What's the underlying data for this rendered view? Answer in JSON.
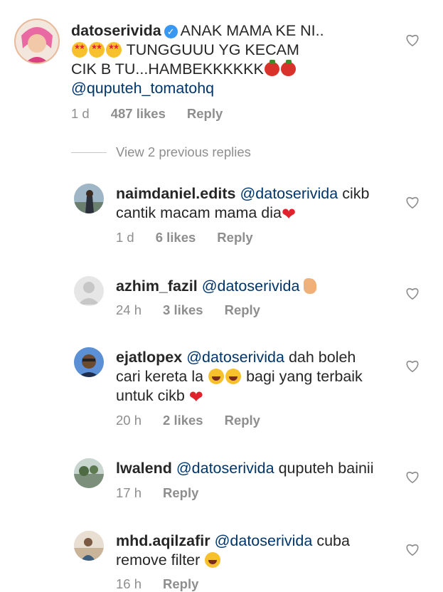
{
  "comments": [
    {
      "username": "datoserivida",
      "verified": true,
      "text_line1": "ANAK MAMA KE NI..",
      "text_line2": "TUNGGUUU YG KECAM",
      "text_line3": "CIK B TU...HAMBEKKKKKK",
      "mention": "@quputeh_tomatohq",
      "time": "1 d",
      "likes": "487 likes",
      "reply": "Reply"
    }
  ],
  "view_previous": "View 2 previous replies",
  "replies": [
    {
      "username": "naimdaniel.edits",
      "mention": "@datoserivida",
      "text_a": "cikb",
      "text_b": "cantik macam mama dia",
      "time": "1 d",
      "likes": "6 likes",
      "reply": "Reply"
    },
    {
      "username": "azhim_fazil",
      "mention": "@datoserivida",
      "time": "24 h",
      "likes": "3 likes",
      "reply": "Reply"
    },
    {
      "username": "ejatlopex",
      "mention": "@datoserivida",
      "text_a": "dah boleh",
      "text_b": "cari kereta la",
      "text_c": "bagi yang terbaik",
      "text_d": "untuk cikb",
      "time": "20 h",
      "likes": "2 likes",
      "reply": "Reply"
    },
    {
      "username": "lwalend",
      "mention": "@datoserivida",
      "text_a": "quputeh bainii",
      "time": "17 h",
      "reply": "Reply"
    },
    {
      "username": "mhd.aqilzafir",
      "mention": "@datoserivida",
      "text_a": "cuba",
      "text_b": "remove filter",
      "time": "16 h",
      "reply": "Reply"
    }
  ],
  "icons": {
    "heart": "heart-outline-icon",
    "verified": "verified-badge-icon"
  },
  "colors": {
    "mention": "#003569",
    "meta": "#8e8e8e",
    "verified": "#3897f0",
    "text": "#262626"
  }
}
